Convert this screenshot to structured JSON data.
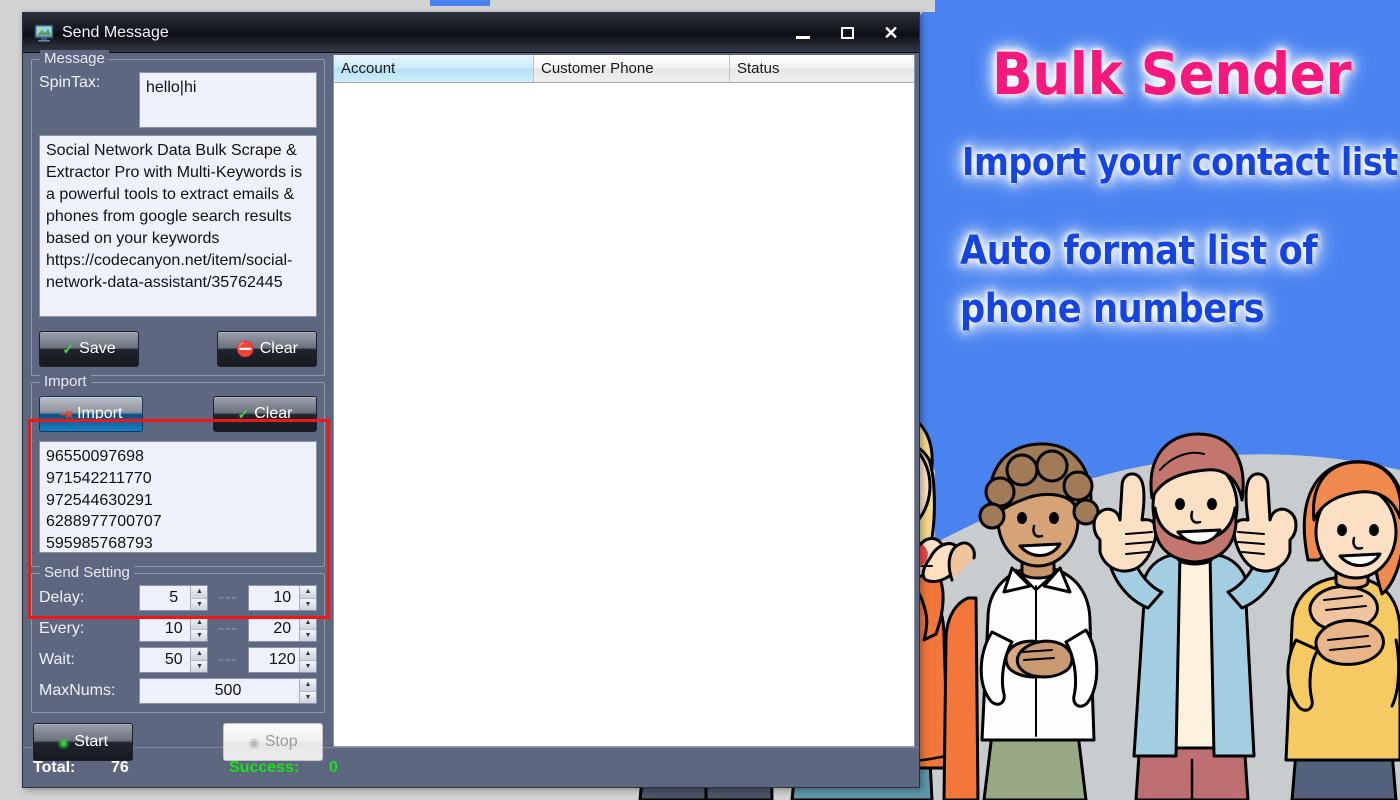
{
  "window": {
    "title": "Send Message",
    "icon": "computer-monitor-icon",
    "minimize_glyph": "–",
    "maximize_glyph": "□",
    "close_glyph": "✕"
  },
  "message_group": {
    "title": "Message",
    "spintax_label": "SpinTax:",
    "spintax_value": "hello|hi",
    "body_value": "Social Network Data Bulk Scrape & Extractor Pro with Multi-Keywords is a powerful tools to extract emails & phones from google search results based on your keywords https://codecanyon.net/item/social-network-data-assistant/35762445",
    "save_label": "Save",
    "clear_label": "Clear",
    "save_icon": "check-icon",
    "clear_icon": "ban-icon"
  },
  "import_group": {
    "title": "Import",
    "import_label": "Import",
    "clear_label": "Clear",
    "import_icon": "import-arrow-icon",
    "clear_icon": "check-icon",
    "highlight_color": "#f41414",
    "numbers": "96550097698\n971542211770\n972544630291\n6288977700707\n595985768793"
  },
  "send_setting": {
    "title": "Send Setting",
    "separator": "---",
    "rows": [
      {
        "label": "Delay:",
        "min": "5",
        "max": "10"
      },
      {
        "label": "Every:",
        "min": "10",
        "max": "20"
      },
      {
        "label": "Wait:",
        "min": "50",
        "max": "120"
      }
    ],
    "maxnums_label": "MaxNums:",
    "maxnums_value": "500"
  },
  "actions": {
    "start_label": "Start",
    "stop_label": "Stop",
    "start_icon": "play-circle-icon",
    "stop_icon": "stop-circle-icon"
  },
  "grid": {
    "columns": [
      {
        "key": "account",
        "label": "Account",
        "selected": true
      },
      {
        "key": "phone",
        "label": "Customer Phone",
        "selected": false
      },
      {
        "key": "status",
        "label": "Status",
        "selected": false
      }
    ],
    "rows": []
  },
  "status_bar": {
    "total_label": "Total:",
    "total_value": "76",
    "success_label": "Success:",
    "success_value": "0",
    "success_color": "#17e117"
  },
  "promo": {
    "title": "Bulk Sender",
    "line1": "Import your contact list",
    "line2": "Auto format list of",
    "line3": "phone numbers",
    "title_color": "#f5197e",
    "line_color": "#1544e0",
    "background_blue": "#4a83f0",
    "background_gray": "#c9ccce"
  }
}
